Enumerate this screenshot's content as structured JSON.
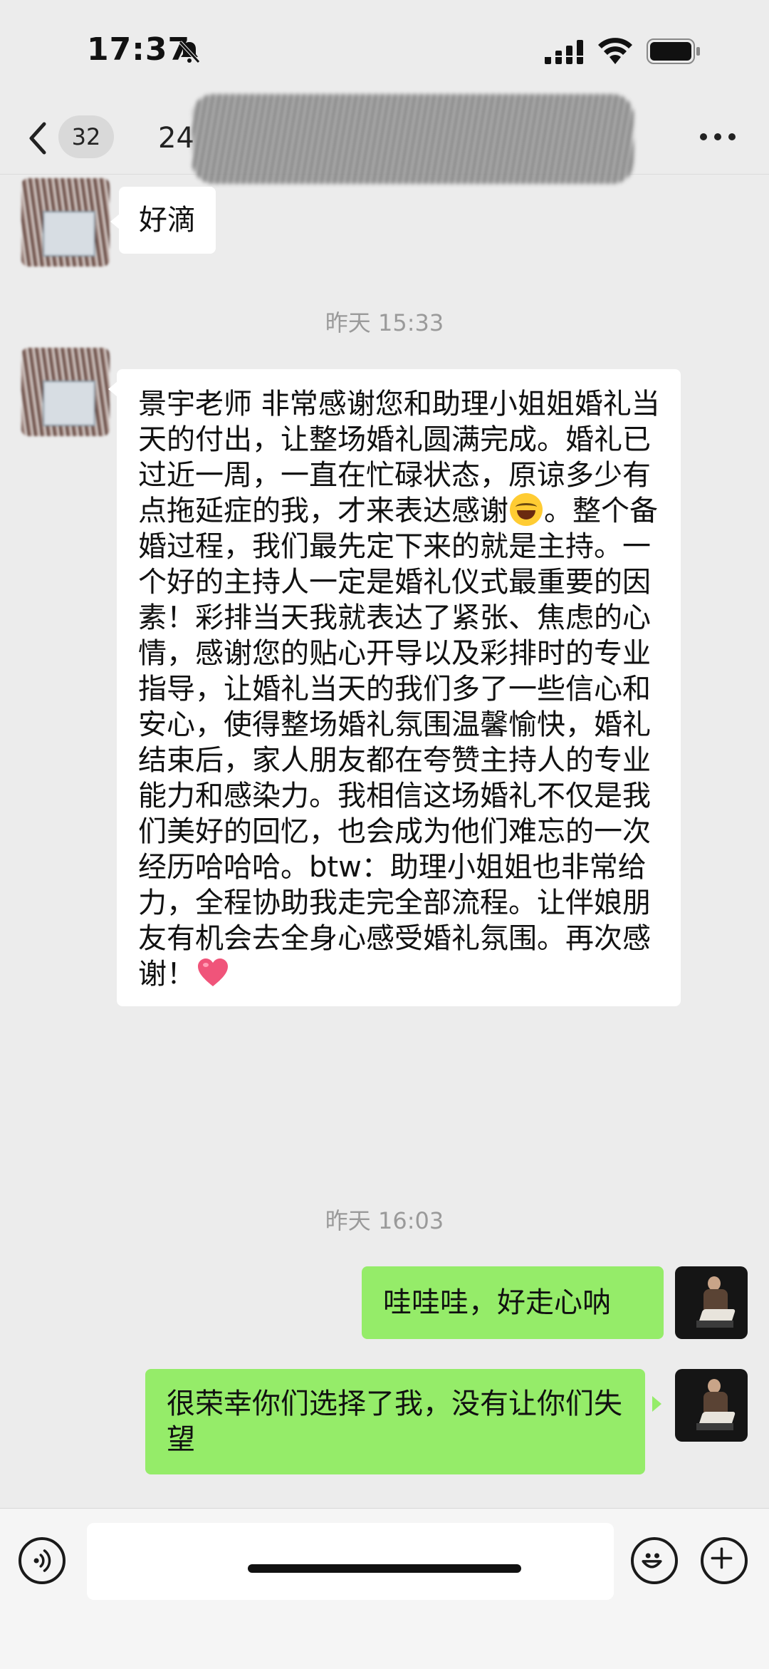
{
  "status_bar": {
    "time": "17:37"
  },
  "header": {
    "unread_count": "32",
    "chat_title": "24",
    "more_icon": "more-dots-icon"
  },
  "messages": [
    {
      "direction": "in",
      "text": "好滴"
    },
    {
      "timestamp": "昨天 15:33"
    },
    {
      "direction": "in",
      "text_before_emoji": "景宇老师 非常感谢您和助理小姐姐婚礼当天的付出，让整场婚礼圆满完成。婚礼已过近一周，一直在忙碌状态，原谅多少有点拖延症的我，才来表达感谢",
      "text_after_emoji": "。整个备婚过程，我们最先定下来的就是主持。一个好的主持人一定是婚礼仪式最重要的因素！彩排当天我就表达了紧张、焦虑的心情，感谢您的贴心开导以及彩排时的专业指导，让婚礼当天的我们多了一些信心和安心，使得整场婚礼氛围温馨愉快，婚礼结束后，家人朋友都在夸赞主持人的专业能力和感染力。我相信这场婚礼不仅是我们美好的回忆，也会成为他们难忘的一次经历哈哈哈。btw：助理小姐姐也非常给力，全程协助我走完全部流程。让伴娘朋友有机会去全身心感受婚礼氛围。再次感谢！",
      "emojis": [
        "laughing-crying-emoji",
        "heart-emoji"
      ]
    },
    {
      "timestamp": "昨天 16:03"
    },
    {
      "direction": "out",
      "text": "哇哇哇，好走心呐"
    },
    {
      "direction": "out",
      "text": "很荣幸你们选择了我，没有让你们失望"
    }
  ],
  "input_bar": {
    "voice_icon": "voice-icon",
    "emoji_icon": "emoji-icon",
    "plus_icon": "plus-icon"
  },
  "colors": {
    "background": "#ececec",
    "incoming_bubble": "#ffffff",
    "outgoing_bubble": "#95ec69"
  }
}
